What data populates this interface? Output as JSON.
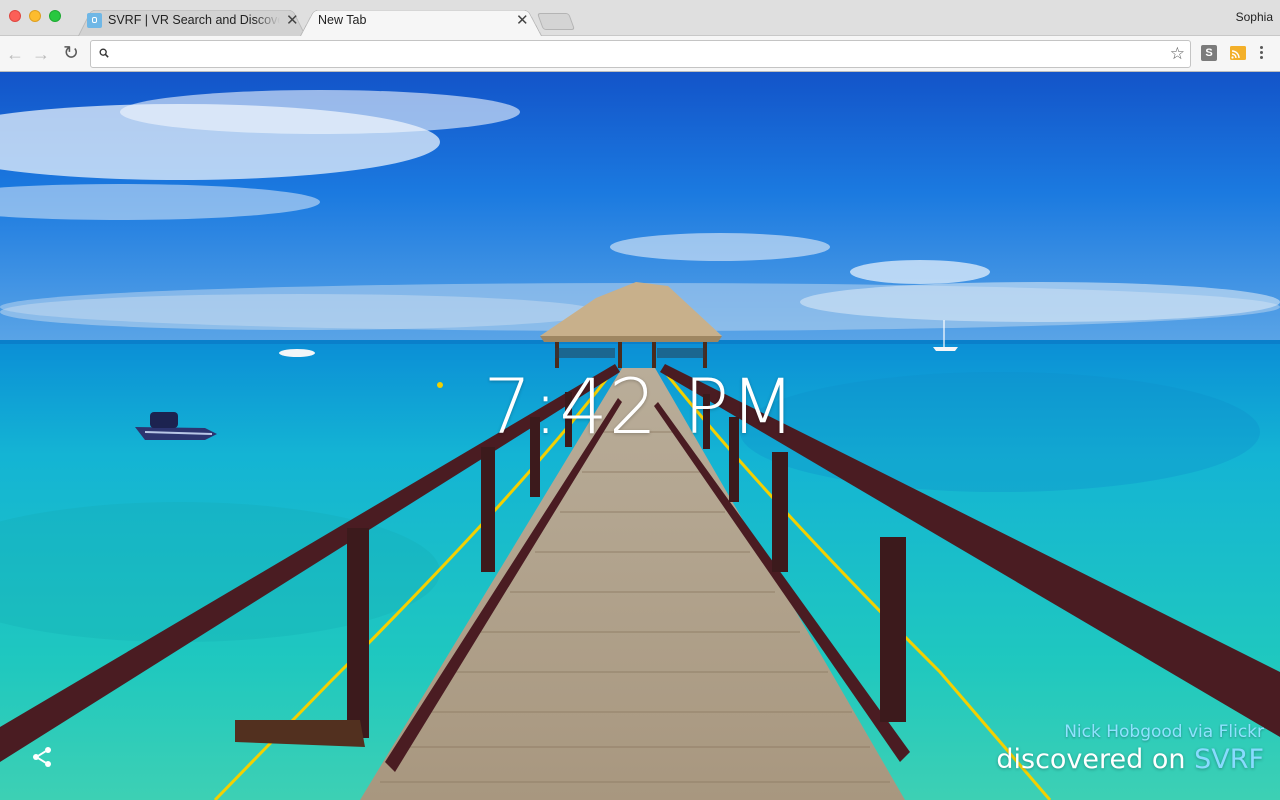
{
  "window": {
    "profile_name": "Sophia",
    "tabs": [
      {
        "title": "SVRF | VR Search and Discovery",
        "active": false
      },
      {
        "title": "New Tab",
        "active": true
      }
    ]
  },
  "toolbar": {
    "address_value": "",
    "extension_s_label": "S",
    "icons": [
      "back-icon",
      "forward-icon",
      "reload-icon",
      "search-icon",
      "star-icon",
      "svrf-extension-icon",
      "cast-icon",
      "menu-icon"
    ]
  },
  "new_tab": {
    "clock": "7:42 PM",
    "credit_line": "Nick Hobgood via Flickr",
    "discovered_prefix": "discovered on",
    "brand": "SVRF",
    "brand_color": "#88dbff",
    "share_icon": "share-icon"
  },
  "colors": {
    "sky_top": "#1460d6",
    "sea": "#1fc2c4",
    "railing": "#4a1c22",
    "rope": "#f4d000"
  }
}
